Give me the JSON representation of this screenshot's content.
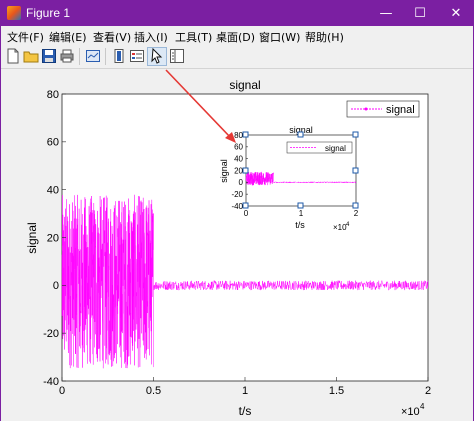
{
  "window": {
    "title": "Figure 1",
    "controls": [
      "—",
      "☐",
      "✕"
    ]
  },
  "menu": {
    "items": [
      "文件(F)",
      "编辑(E)",
      "查看(V)",
      "插入(I)",
      "工具(T)",
      "桌面(D)",
      "窗口(W)",
      "帮助(H)"
    ]
  },
  "toolbar": {
    "icons": [
      "new-figure-icon",
      "open-file-icon",
      "save-icon",
      "print-icon",
      "link-plot-icon",
      "insert-colorbar-icon",
      "insert-legend-icon",
      "edit-plot-arrow-icon",
      "property-inspector-icon"
    ],
    "highlight_color": "#e53935"
  },
  "chart_data": [
    {
      "type": "line",
      "title": "signal",
      "xlabel": "t/s",
      "ylabel": "signal",
      "xlim": [
        0,
        20000
      ],
      "ylim": [
        -40,
        80
      ],
      "xticks": [
        "0",
        "0.5",
        "1",
        "1.5",
        "2"
      ],
      "yticks": [
        "-40",
        "-20",
        "0",
        "20",
        "40",
        "60",
        "80"
      ],
      "x_exponent": "×10",
      "x_exponent_power": "4",
      "legend": {
        "label": "signal",
        "position": "top-right"
      },
      "series": [
        {
          "name": "signal",
          "color": "#ff00ff",
          "segments": [
            {
              "x_range": [
                0,
                5000
              ],
              "y_range": [
                -35,
                38
              ]
            },
            {
              "x_range": [
                5000,
                20000
              ],
              "y_range": [
                -2,
                2
              ]
            }
          ]
        }
      ],
      "grid": false
    },
    {
      "type": "line",
      "title": "signal",
      "xlabel": "t/s",
      "ylabel": "signal",
      "xlim": [
        0,
        20000
      ],
      "ylim": [
        -40,
        80
      ],
      "xticks": [
        "0",
        "1",
        "2"
      ],
      "yticks": [
        "-40",
        "-20",
        "0",
        "20",
        "40",
        "60",
        "80"
      ],
      "x_exponent": "×10",
      "x_exponent_power": "4",
      "legend": {
        "label": "signal",
        "position": "top-right"
      },
      "series": [
        {
          "name": "signal",
          "color": "#ff00ff",
          "segments": [
            {
              "x_range": [
                0,
                5000
              ],
              "y_range": [
                -5,
                18
              ]
            },
            {
              "x_range": [
                5000,
                20000
              ],
              "y_range": [
                -1,
                1
              ]
            }
          ]
        }
      ],
      "grid": false
    }
  ],
  "colors": {
    "titlebar": "#7b1fa2",
    "annotation_arrow": "#e53935",
    "series": "#ff00ff"
  }
}
